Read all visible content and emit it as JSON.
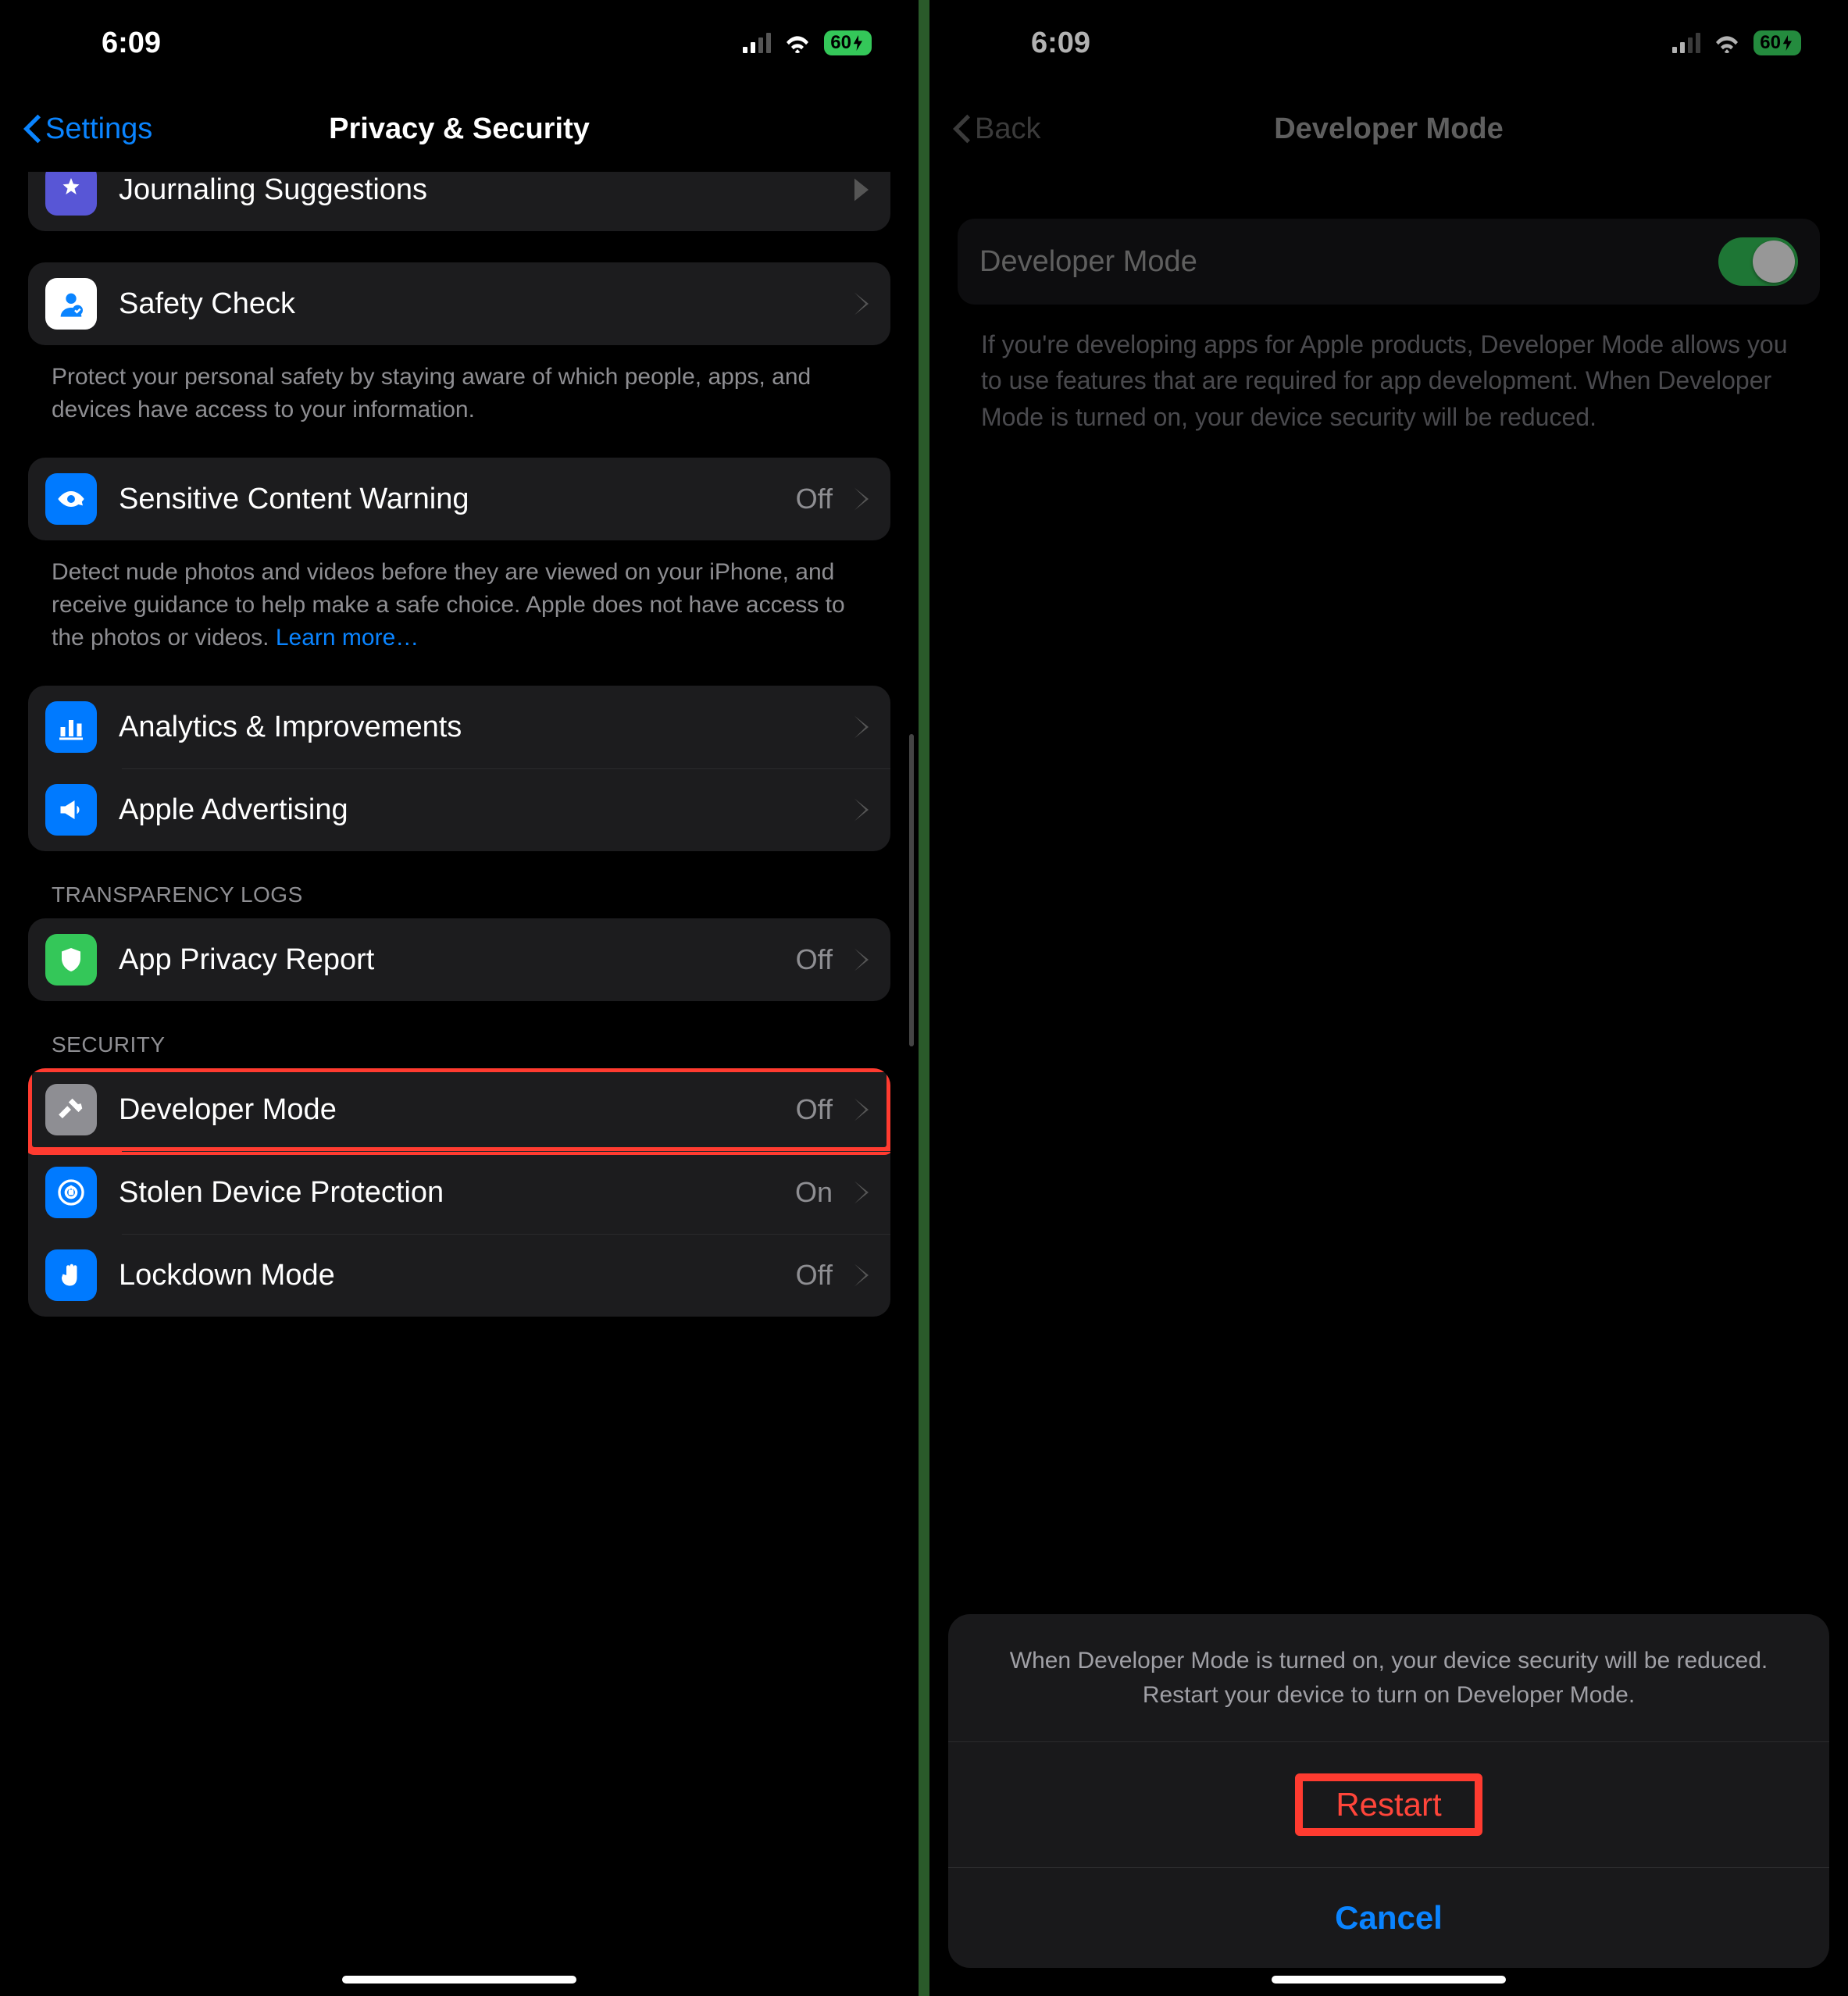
{
  "status": {
    "time": "6:09",
    "battery": "60"
  },
  "left": {
    "back": "Settings",
    "title": "Privacy & Security",
    "journaling_label": "Journaling Suggestions",
    "safety_check": {
      "label": "Safety Check",
      "footer": "Protect your personal safety by staying aware of which people, apps, and devices have access to your information."
    },
    "scw": {
      "label": "Sensitive Content Warning",
      "value": "Off",
      "footer": "Detect nude photos and videos before they are viewed on your iPhone, and receive guidance to help make a safe choice. Apple does not have access to the photos or videos. ",
      "learn_more": "Learn more…"
    },
    "analytics": {
      "a": "Analytics & Improvements",
      "b": "Apple Advertising"
    },
    "transparency_header": "TRANSPARENCY LOGS",
    "app_privacy": {
      "label": "App Privacy Report",
      "value": "Off"
    },
    "security_header": "SECURITY",
    "security": {
      "dev": {
        "label": "Developer Mode",
        "value": "Off"
      },
      "stolen": {
        "label": "Stolen Device Protection",
        "value": "On"
      },
      "lockdown": {
        "label": "Lockdown Mode",
        "value": "Off"
      }
    }
  },
  "right": {
    "back": "Back",
    "title": "Developer Mode",
    "toggle_label": "Developer Mode",
    "desc": "If you're developing apps for Apple products, Developer Mode allows you to use features that are required for app development. When Developer Mode is turned on, your device security will be reduced.",
    "sheet": {
      "msg": "When Developer Mode is turned on, your device security will be reduced. Restart your device to turn on Developer Mode.",
      "restart": "Restart",
      "cancel": "Cancel"
    }
  }
}
